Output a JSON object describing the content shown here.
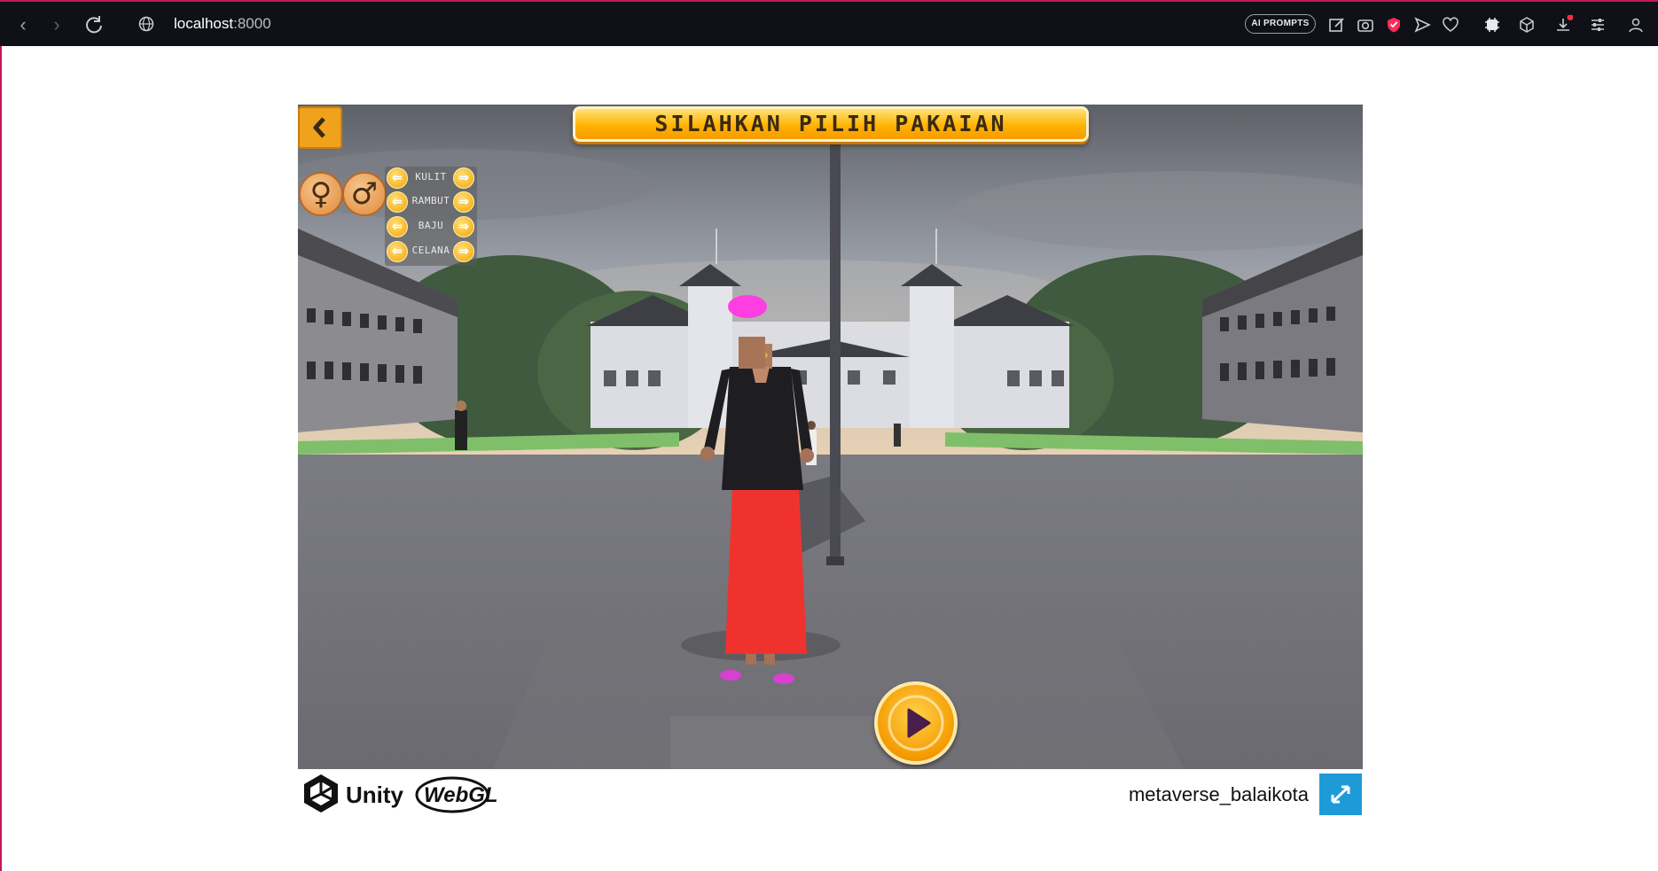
{
  "browser": {
    "url_host": "localhost",
    "url_port": ":8000",
    "ai_prompts_label": "AI PROMPTS",
    "accent_color": "#c2185b",
    "toolbar_icons": [
      "edit-icon",
      "camera-icon",
      "shield-icon",
      "send-icon",
      "heart-icon",
      "extensions-icon",
      "cube-icon",
      "download-icon",
      "settings-icon",
      "profile-icon"
    ]
  },
  "game": {
    "title": "SILAHKAN PILIH PAKAIAN",
    "gender_female_symbol": "♀",
    "gender_male_symbol": "♂",
    "options": [
      {
        "label": "KULIT"
      },
      {
        "label": "RAMBUT"
      },
      {
        "label": "BAJU"
      },
      {
        "label": "CELANA"
      }
    ],
    "arrow_left_glyph": "⇐",
    "arrow_right_glyph": "⇒",
    "accent_color": "#ffb300"
  },
  "footer": {
    "unity_label": "Unity",
    "webgl_label": "WebGL",
    "build_title": "metaverse_balaikota",
    "fullscreen_color": "#1e9bd7"
  }
}
